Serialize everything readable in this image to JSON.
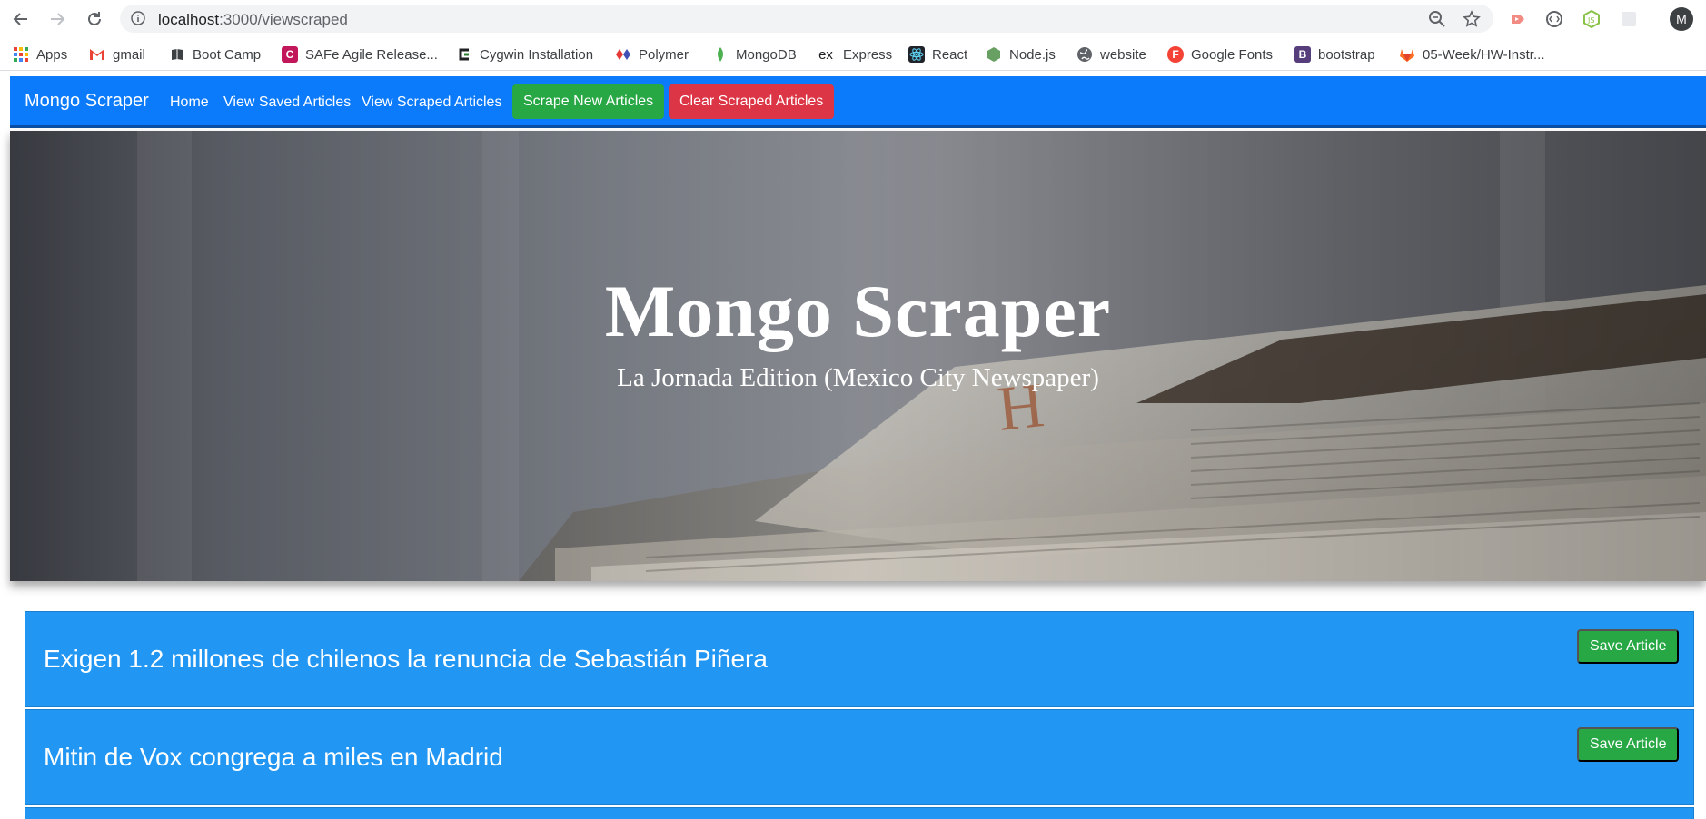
{
  "browser": {
    "url_host": "localhost",
    "url_path": ":3000/viewscraped",
    "profile_initial": "M",
    "bookmarks": [
      {
        "label": "Apps",
        "icon": "apps-grid-icon",
        "color": "#ea4335"
      },
      {
        "label": "gmail",
        "icon": "gmail-icon",
        "color": "#ea4335"
      },
      {
        "label": "Boot Camp",
        "icon": "book-icon",
        "color": "#3c4043"
      },
      {
        "label": "SAFe Agile Release...",
        "icon": "safe-icon",
        "color": "#c2185b"
      },
      {
        "label": "Cygwin Installation",
        "icon": "cygwin-icon",
        "color": "#2e7d32"
      },
      {
        "label": "Polymer",
        "icon": "polymer-icon",
        "color": "#e53935"
      },
      {
        "label": "MongoDB",
        "icon": "mongodb-leaf-icon",
        "color": "#4caf50"
      },
      {
        "label": "Express",
        "icon": "express-icon",
        "color": "#202124"
      },
      {
        "label": "React",
        "icon": "react-icon",
        "color": "#61dafb"
      },
      {
        "label": "Node.js",
        "icon": "nodejs-icon",
        "color": "#68a063"
      },
      {
        "label": "website",
        "icon": "globe-icon",
        "color": "#5f6368"
      },
      {
        "label": "Google Fonts",
        "icon": "google-fonts-icon",
        "color": "#f44336"
      },
      {
        "label": "bootstrap",
        "icon": "bootstrap-icon",
        "color": "#563d7c"
      },
      {
        "label": "05-Week/HW-Instr...",
        "icon": "gitlab-icon",
        "color": "#fc6d26"
      }
    ]
  },
  "navbar": {
    "brand": "Mongo Scraper",
    "links": [
      "Home",
      "View Saved Articles",
      "View Scraped Articles"
    ],
    "scrape_button": "Scrape New Articles",
    "clear_button": "Clear Scraped Articles",
    "color": "#0b7bfc"
  },
  "hero": {
    "title": "Mongo Scraper",
    "subtitle": "La Jornada Edition (Mexico City Newspaper)"
  },
  "articles": [
    {
      "title": "Exigen 1.2 millones de chilenos la renuncia de Sebastián Piñera",
      "save_label": "Save Article"
    },
    {
      "title": "Mitin de Vox congrega a miles en Madrid",
      "save_label": "Save Article"
    }
  ],
  "colors": {
    "article_bg": "#2196f3",
    "save_button": "#28a745",
    "clear_button": "#dc3545"
  }
}
